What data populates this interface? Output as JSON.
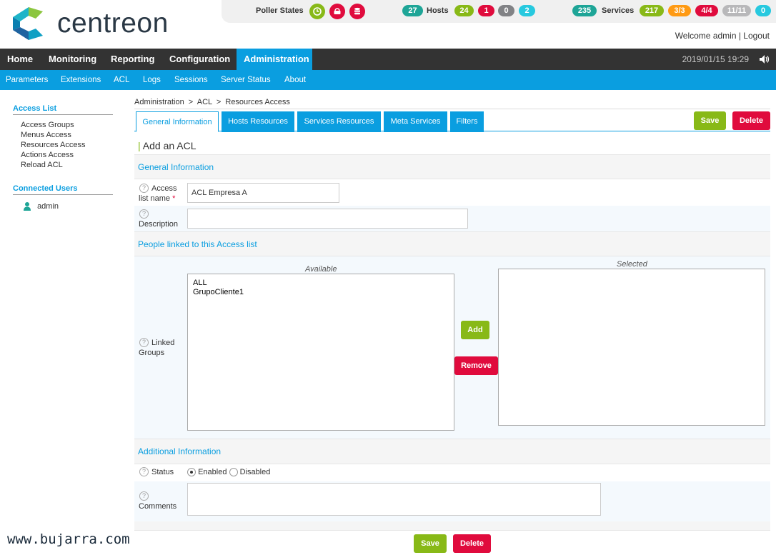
{
  "brand": {
    "name": "centreon"
  },
  "topbar": {
    "poller_label": "Poller States",
    "hosts_label": "Hosts",
    "services_label": "Services",
    "hosts": [
      "27",
      "24",
      "1",
      "0",
      "2"
    ],
    "services": [
      "235",
      "217",
      "3/3",
      "4/4",
      "11/11",
      "0"
    ],
    "welcome": "Welcome admin | Logout"
  },
  "nav": {
    "items": [
      "Home",
      "Monitoring",
      "Reporting",
      "Configuration",
      "Administration"
    ],
    "datetime": "2019/01/15 19:29"
  },
  "subnav": {
    "items": [
      "Parameters",
      "Extensions",
      "ACL",
      "Logs",
      "Sessions",
      "Server Status",
      "About"
    ]
  },
  "sidebar": {
    "access_list_title": "Access List",
    "links": [
      "Access Groups",
      "Menus Access",
      "Resources Access",
      "Actions Access",
      "Reload ACL"
    ],
    "connected_title": "Connected Users",
    "user": "admin"
  },
  "breadcrumb": "Administration  >  ACL  >  Resources Access",
  "tabs": [
    "General Information",
    "Hosts Resources",
    "Services Resources",
    "Meta Services",
    "Filters"
  ],
  "buttons": {
    "save": "Save",
    "delete": "Delete",
    "add": "Add",
    "remove": "Remove"
  },
  "page_title": "Add an ACL",
  "form": {
    "general_section": "General Information",
    "access_name_label": "Access list name",
    "access_name_value": "ACL Empresa A",
    "description_label": "Description",
    "description_value": "",
    "people_section": "People linked to this Access list",
    "linked_groups_label": "Linked Groups",
    "available_caption": "Available",
    "selected_caption": "Selected",
    "available_items": [
      "ALL",
      "GrupoCliente1"
    ],
    "additional_section": "Additional Information",
    "status_label": "Status",
    "status_enabled": "Enabled",
    "status_disabled": "Disabled",
    "comments_label": "Comments",
    "comments_value": ""
  },
  "colors": {
    "accent": "#0a9ee0",
    "green": "#88b917",
    "red": "#e00b3d",
    "orange": "#ff9a13",
    "teal": "#1ea597",
    "grey": "#818285",
    "cyan": "#27c9df"
  },
  "watermark": "www.bujarra.com"
}
